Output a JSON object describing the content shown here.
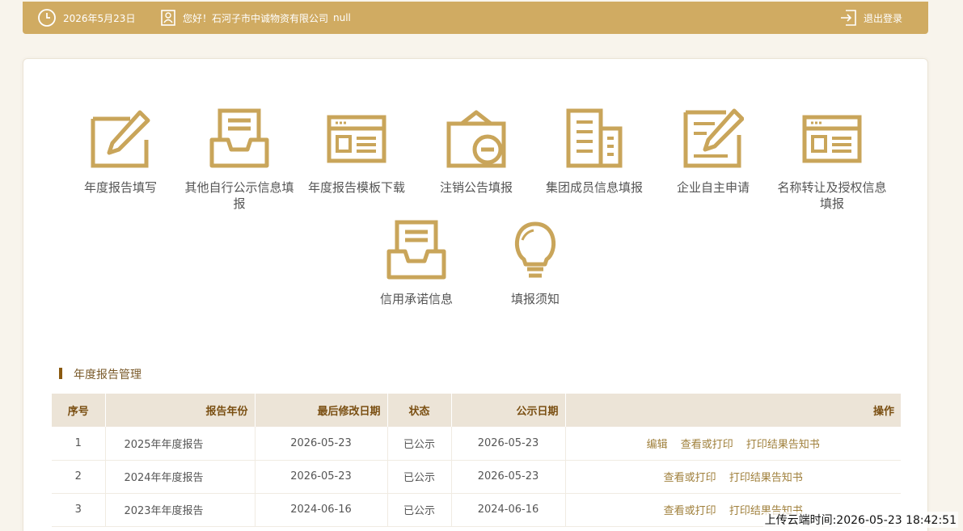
{
  "header": {
    "date": "2026年5月23日",
    "greeting": "您好！石河子市中诚物资有限公司",
    "user_suffix": "null",
    "logout_label": "退出登录"
  },
  "menu": {
    "tiles": [
      {
        "label": "年度报告填写",
        "icon": "edit-icon"
      },
      {
        "label": "其他自行公示信息填报",
        "icon": "inbox-document-icon"
      },
      {
        "label": "年度报告模板下载",
        "icon": "template-window-icon"
      },
      {
        "label": "注销公告填报",
        "icon": "cancel-notice-icon"
      },
      {
        "label": "集团成员信息填报",
        "icon": "group-buildings-icon"
      },
      {
        "label": "企业自主申请",
        "icon": "edit-document-icon"
      },
      {
        "label": "名称转让及授权信息填报",
        "icon": "transfer-window-icon"
      },
      {
        "label": "信用承诺信息",
        "icon": "inbox-document-icon"
      },
      {
        "label": "填报须知",
        "icon": "lightbulb-icon"
      }
    ]
  },
  "section": {
    "title": "年度报告管理"
  },
  "table": {
    "headers": [
      "序号",
      "报告年份",
      "最后修改日期",
      "状态",
      "公示日期",
      "操作"
    ],
    "rows": [
      {
        "no": "1",
        "year": "2025年年度报告",
        "modified": "2026-05-23",
        "status": "已公示",
        "published": "2026-05-23",
        "actions": [
          "编辑",
          "查看或打印",
          "打印结果告知书"
        ]
      },
      {
        "no": "2",
        "year": "2024年年度报告",
        "modified": "2026-05-23",
        "status": "已公示",
        "published": "2026-05-23",
        "actions": [
          "查看或打印",
          "打印结果告知书"
        ]
      },
      {
        "no": "3",
        "year": "2023年年度报告",
        "modified": "2024-06-16",
        "status": "已公示",
        "published": "2024-06-16",
        "actions": [
          "查看或打印",
          "打印结果告知书"
        ]
      }
    ]
  },
  "footer": {
    "upload_time": "上传云端时间:2026-05-23 18:42:51"
  },
  "colors": {
    "accent": "#d0ab62",
    "icon": "#c9a55a",
    "header_text": "#7a4f12"
  }
}
